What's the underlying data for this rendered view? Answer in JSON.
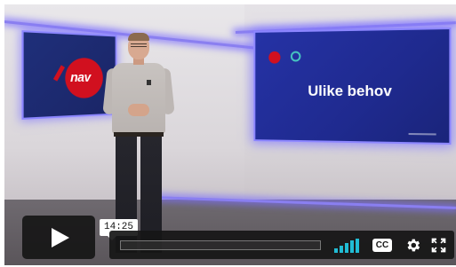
{
  "video": {
    "left_screen": {
      "logo_text": "nav"
    },
    "right_screen": {
      "title": "Ulike behov"
    }
  },
  "controls": {
    "play_icon": "play-icon",
    "time_tooltip": "14:25",
    "progress_fraction": 0.0,
    "volume_icon": "volume-bars-icon",
    "captions_label": "CC",
    "settings_icon": "gear-icon",
    "fullscreen_icon": "fullscreen-icon",
    "accent_color": "#21bcd4"
  }
}
